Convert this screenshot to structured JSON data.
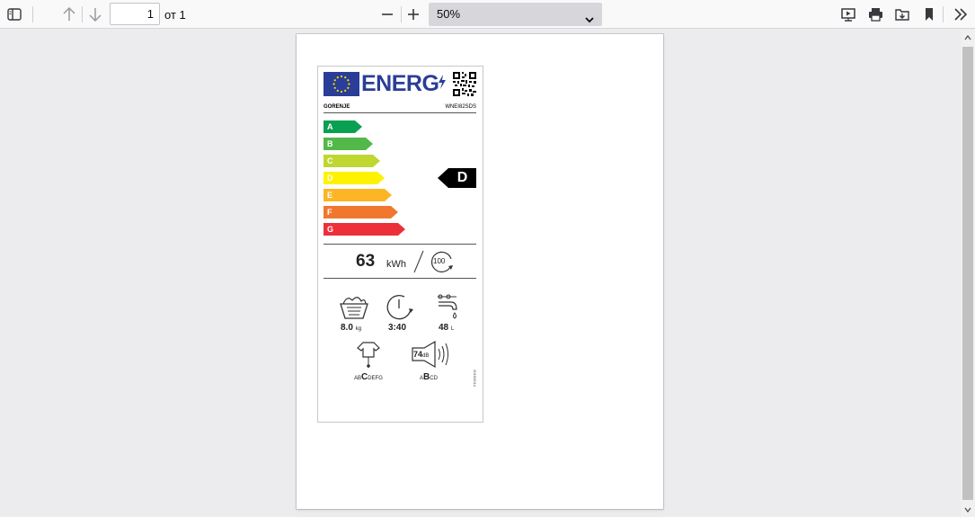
{
  "toolbar": {
    "page_number": "1",
    "page_total_label": "от 1",
    "zoom_value": "50%"
  },
  "label": {
    "energy_title": "ENERG",
    "brand": "GORENJE",
    "model": "WNEI82SDS",
    "classes": [
      {
        "letter": "A",
        "color": "#0aa052"
      },
      {
        "letter": "B",
        "color": "#52b848"
      },
      {
        "letter": "C",
        "color": "#bfd730"
      },
      {
        "letter": "D",
        "color": "#fff200"
      },
      {
        "letter": "E",
        "color": "#fcb524"
      },
      {
        "letter": "F",
        "color": "#f1772f"
      },
      {
        "letter": "G",
        "color": "#ed2f3a"
      }
    ],
    "rating": "D",
    "energy_value": "63",
    "energy_unit": "kWh",
    "cycles": "100",
    "capacity_value": "8.0",
    "capacity_unit": "kg",
    "duration": "3:40",
    "water_value": "48",
    "water_unit": "L",
    "spin_scale_pre": "AB",
    "spin_scale_sel": "C",
    "spin_scale_post": "DEFG",
    "noise_value": "74",
    "noise_unit": "dB",
    "noise_scale_pre": "A",
    "noise_scale_sel": "B",
    "noise_scale_post": "CD",
    "regulation_code": "2019/2014"
  },
  "colors": {
    "eu_blue": "#2a3e97",
    "toolbar_bg": "#f9f9fa",
    "viewer_bg": "#ececee"
  },
  "icons": [
    "sidebar-toggle-icon",
    "arrow-up-icon",
    "arrow-down-icon",
    "minus-icon",
    "plus-icon",
    "chevron-down-icon",
    "presentation-icon",
    "print-icon",
    "save-icon",
    "bookmark-icon",
    "double-chevron-right-icon"
  ]
}
